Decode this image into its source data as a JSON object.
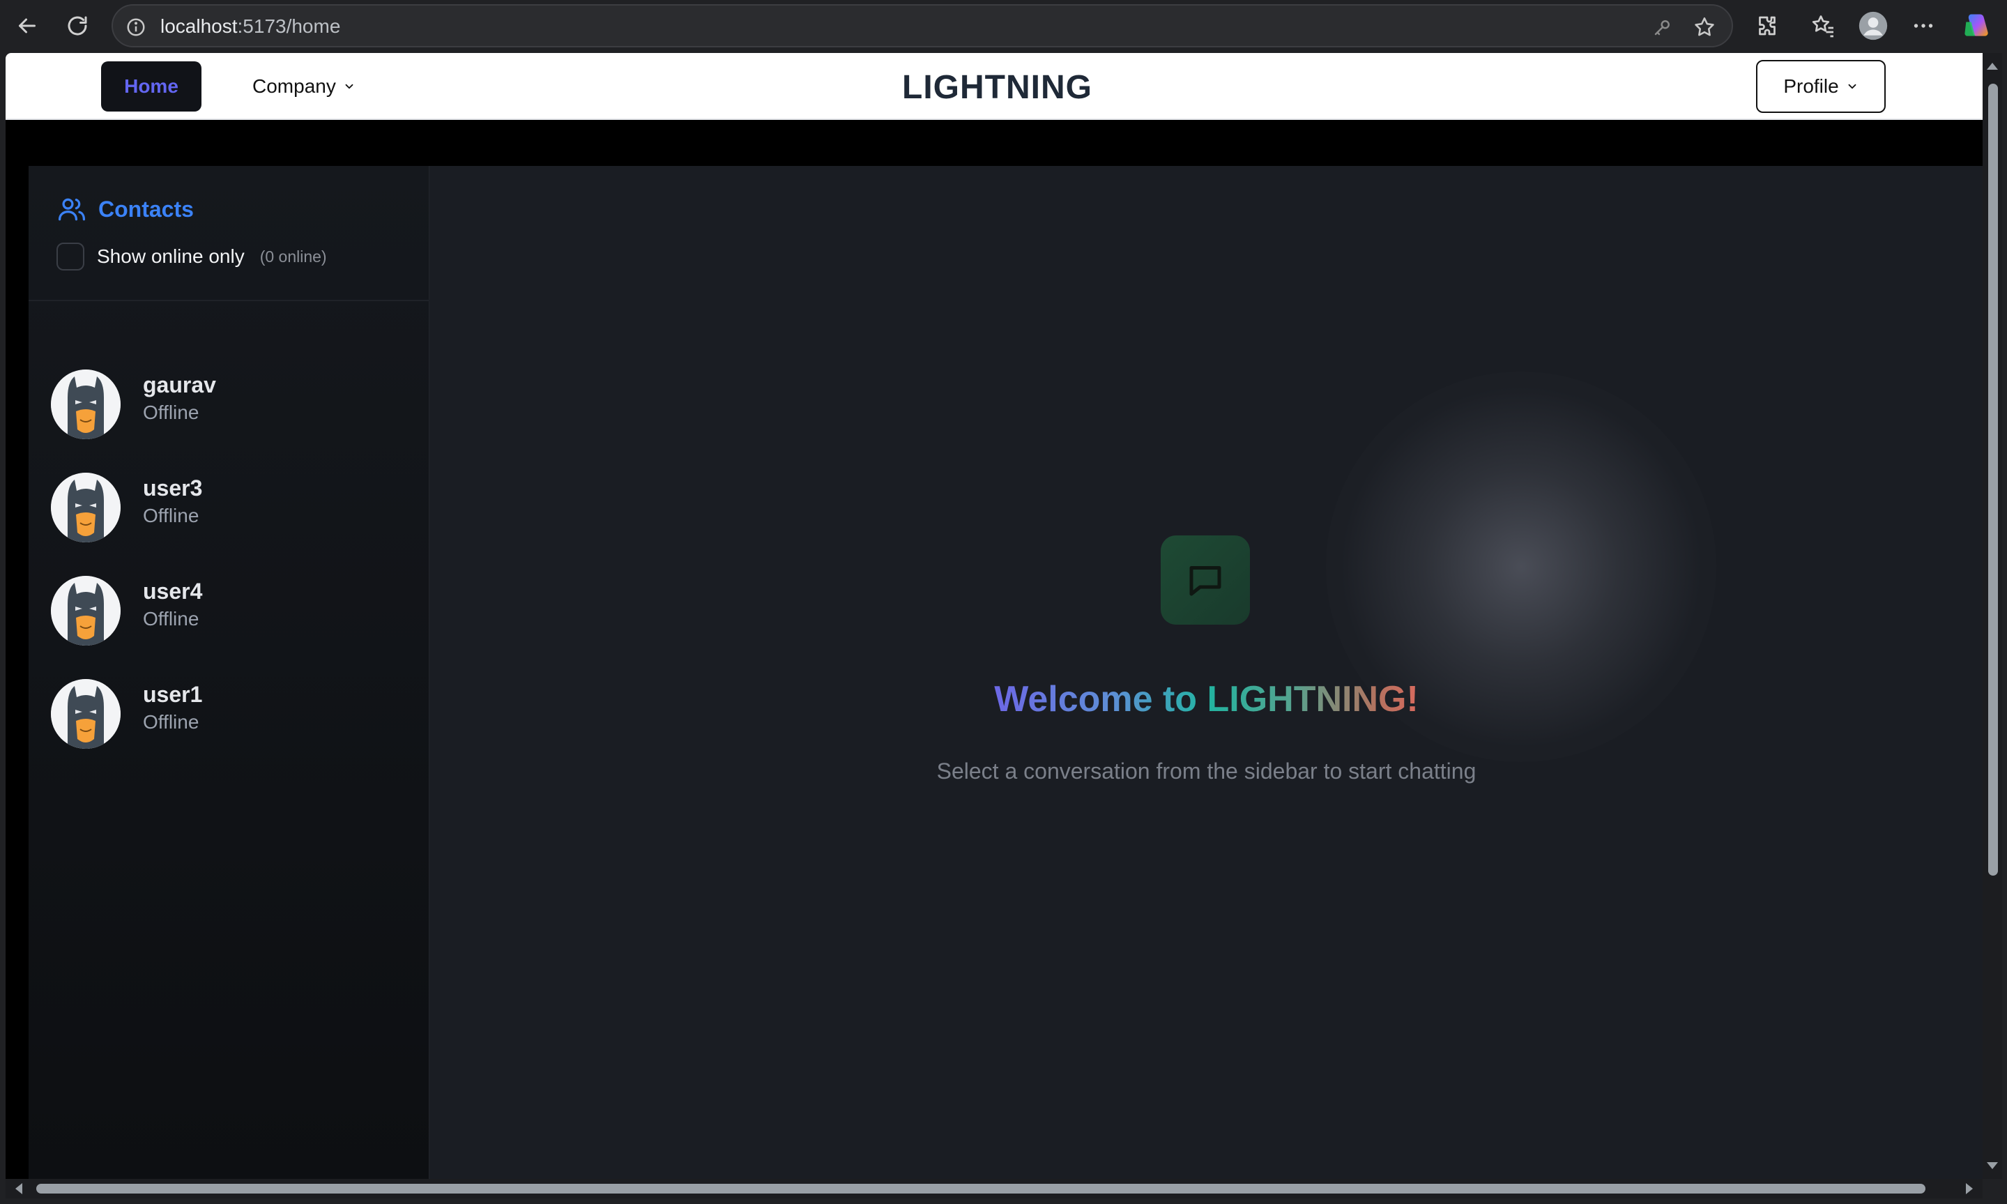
{
  "browser": {
    "url_host": "localhost",
    "url_rest": ":5173/home"
  },
  "navbar": {
    "home_label": "Home",
    "company_label": "Company",
    "brand": "LIGHTNING",
    "profile_label": "Profile"
  },
  "sidebar": {
    "title": "Contacts",
    "online_filter_label": "Show online only",
    "online_count": "(0 online)",
    "contacts": [
      {
        "name": "gaurav",
        "status": "Offline"
      },
      {
        "name": "user3",
        "status": "Offline"
      },
      {
        "name": "user4",
        "status": "Offline"
      },
      {
        "name": "user1",
        "status": "Offline"
      }
    ]
  },
  "main": {
    "welcome_prefix": "Welcome to ",
    "welcome_brand": "LIGHTNING!",
    "subtitle": "Select a conversation from the sidebar to start chatting"
  },
  "colors": {
    "accent_blue": "#3b82f6",
    "home_text": "#6366f1",
    "chat_icon_bg": "#1e4a34"
  }
}
